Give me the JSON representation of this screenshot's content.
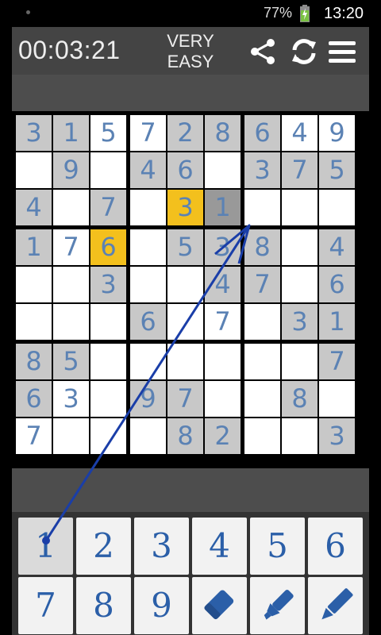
{
  "status": {
    "battery": "77%",
    "time": "13:20"
  },
  "header": {
    "timer": "00:03:21",
    "difficulty_line1": "VERY",
    "difficulty_line2": "EASY",
    "icons": [
      "share-icon",
      "refresh-icon",
      "menu-icon"
    ]
  },
  "board": {
    "rows": [
      [
        "3",
        "1",
        "5",
        "7",
        "2",
        "8",
        "6",
        "4",
        "9"
      ],
      [
        "",
        "9",
        "",
        "4",
        "6",
        "",
        "3",
        "7",
        "5"
      ],
      [
        "4",
        "",
        "7",
        "",
        "3",
        "1",
        "",
        "",
        ""
      ],
      [
        "1",
        "7",
        "6",
        "",
        "5",
        "3",
        "8",
        "",
        "4"
      ],
      [
        "",
        "",
        "3",
        "",
        "",
        "4",
        "7",
        "",
        "6"
      ],
      [
        "",
        "",
        "",
        "6",
        "",
        "7",
        "",
        "3",
        "1"
      ],
      [
        "8",
        "5",
        "",
        "",
        "",
        "",
        "",
        "",
        "7"
      ],
      [
        "6",
        "3",
        "",
        "9",
        "7",
        "",
        "",
        "8",
        ""
      ],
      [
        "7",
        "",
        "",
        "",
        "8",
        "2",
        "",
        "",
        "3"
      ]
    ],
    "given": [
      [
        1,
        1,
        0,
        0,
        1,
        1,
        1,
        0,
        0
      ],
      [
        0,
        1,
        0,
        1,
        1,
        0,
        1,
        1,
        1
      ],
      [
        1,
        0,
        1,
        0,
        0,
        1,
        0,
        0,
        0
      ],
      [
        1,
        0,
        0,
        0,
        1,
        1,
        1,
        0,
        1
      ],
      [
        0,
        0,
        1,
        0,
        0,
        1,
        1,
        0,
        1
      ],
      [
        0,
        0,
        0,
        1,
        0,
        0,
        0,
        1,
        1
      ],
      [
        1,
        1,
        0,
        0,
        0,
        0,
        0,
        0,
        1
      ],
      [
        1,
        0,
        0,
        1,
        1,
        0,
        0,
        1,
        0
      ],
      [
        0,
        0,
        0,
        0,
        1,
        1,
        0,
        0,
        1
      ]
    ],
    "highlight_color": "#f3c01d",
    "digit_color": "#5b82b4",
    "selected": [
      [
        2,
        4
      ],
      [
        3,
        2
      ]
    ],
    "dimmed": [
      [
        2,
        5
      ]
    ]
  },
  "keypad": {
    "digits": [
      "1",
      "2",
      "3",
      "4",
      "5",
      "6",
      "7",
      "8",
      "9"
    ],
    "tools": [
      "eraser-icon",
      "highlighter-icon",
      "pencil-icon"
    ],
    "accent": "#2b5fa8"
  },
  "annotation": {
    "arrow_color": "#1a3ea8"
  }
}
